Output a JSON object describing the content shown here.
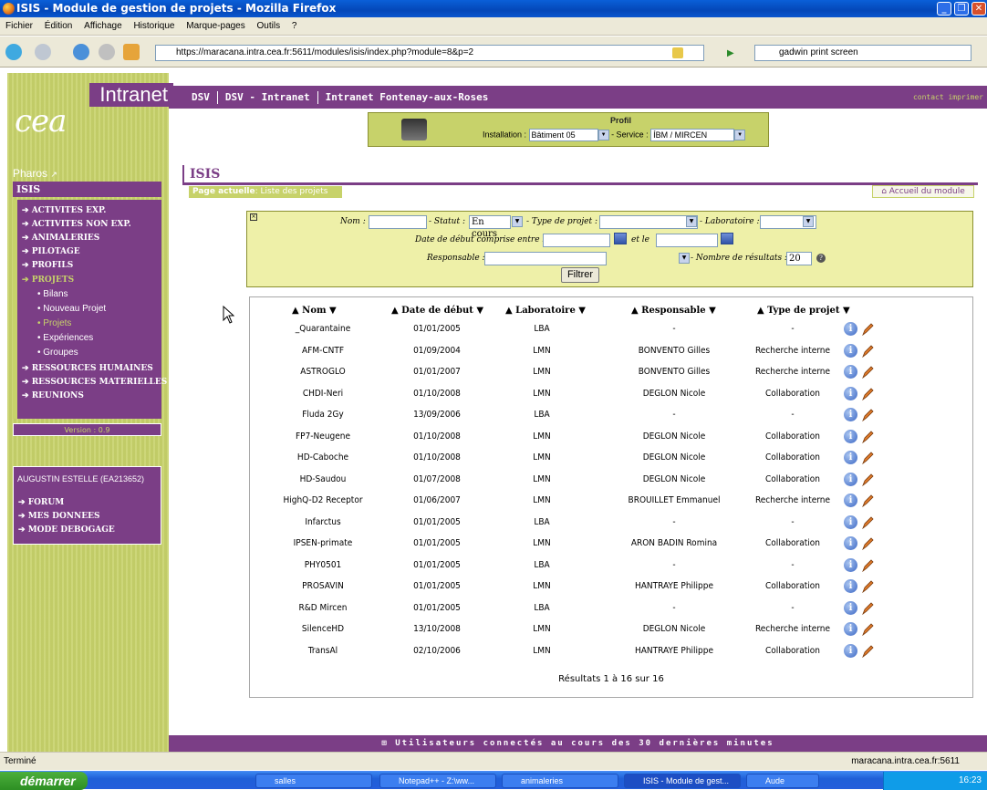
{
  "window": {
    "title": "ISIS - Module de gestion de projets - Mozilla Firefox"
  },
  "menu": [
    "Fichier",
    "Édition",
    "Affichage",
    "Historique",
    "Marque-pages",
    "Outils",
    "?"
  ],
  "nav": {
    "url": "https://maracana.intra.cea.fr:5611/modules/isis/index.php?module=8&p=2",
    "search_value": "gadwin print screen"
  },
  "site": {
    "intranet_label": "Intranet",
    "topnav": [
      "DSV",
      "DSV - Intranet",
      "Intranet Fontenay-aux-Roses"
    ],
    "topnav_right": "contact  imprimer",
    "pharos": "Pharos"
  },
  "profil": {
    "title": "Profil",
    "installation_label": "Installation :",
    "installation_value": "Bâtiment 05",
    "service_label": "- Service :",
    "service_value": "ÍBM / MIRCEN"
  },
  "sidebar": {
    "section": "ISIS",
    "items": [
      {
        "label": "ACTIVITES EXP."
      },
      {
        "label": "ACTIVITES NON EXP."
      },
      {
        "label": "ANIMALERIES"
      },
      {
        "label": "PILOTAGE"
      },
      {
        "label": "PROFILS"
      },
      {
        "label": "PROJETS"
      }
    ],
    "subitems": [
      "Bilans",
      "Nouveau Projet",
      "Projets",
      "Expériences",
      "Groupes"
    ],
    "items2": [
      {
        "label": "RESSOURCES HUMAINES"
      },
      {
        "label": "RESSOURCES MATERIELLES"
      },
      {
        "label": "REUNIONS"
      }
    ],
    "version": "Version : 0.9",
    "user": "AUGUSTIN ESTELLE (EA213652)",
    "user_items": [
      "FORUM",
      "MES DONNEES",
      "MODE DEBOGAGE"
    ]
  },
  "page": {
    "title": "ISIS",
    "current_label": "Page actuelle",
    "current_value": ": Liste des projets",
    "home_link": "Accueil du module"
  },
  "filter": {
    "nom_label": "Nom :",
    "statut_label": "- Statut :",
    "statut_value": "En cours",
    "type_label": "- Type de projet :",
    "labo_label": "- Laboratoire :",
    "date_label": "Date de début comprise entre le",
    "and_label": "et le",
    "resp_label": "Responsable :",
    "nb_label": "- Nombre de résultats :",
    "nb_value": "20",
    "button": "Filtrer"
  },
  "table": {
    "headers": [
      "Nom",
      "Date de début",
      "Laboratoire",
      "Responsable",
      "Type de projet"
    ],
    "rows": [
      [
        "_Quarantaine",
        "01/01/2005",
        "LBA",
        "-",
        "-"
      ],
      [
        "AFM-CNTF",
        "01/09/2004",
        "LMN",
        "BONVENTO Gilles",
        "Recherche interne"
      ],
      [
        "ASTROGLO",
        "01/01/2007",
        "LMN",
        "BONVENTO Gilles",
        "Recherche interne"
      ],
      [
        "CHDI-Neri",
        "01/10/2008",
        "LMN",
        "DEGLON Nicole",
        "Collaboration"
      ],
      [
        "Fluda 2Gy",
        "13/09/2006",
        "LBA",
        "-",
        "-"
      ],
      [
        "FP7-Neugene",
        "01/10/2008",
        "LMN",
        "DEGLON Nicole",
        "Collaboration"
      ],
      [
        "HD-Caboche",
        "01/10/2008",
        "LMN",
        "DEGLON Nicole",
        "Collaboration"
      ],
      [
        "HD-Saudou",
        "01/07/2008",
        "LMN",
        "DEGLON Nicole",
        "Collaboration"
      ],
      [
        "HighQ-D2 Receptor",
        "01/06/2007",
        "LMN",
        "BROUILLET Emmanuel",
        "Recherche interne"
      ],
      [
        "Infarctus",
        "01/01/2005",
        "LBA",
        "-",
        "-"
      ],
      [
        "IPSEN-primate",
        "01/01/2005",
        "LMN",
        "ARON BADIN Romina",
        "Collaboration"
      ],
      [
        "PHY0501",
        "01/01/2005",
        "LBA",
        "-",
        "-"
      ],
      [
        "PROSAVIN",
        "01/01/2005",
        "LMN",
        "HANTRAYE Philippe",
        "Collaboration"
      ],
      [
        "R&D Mircen",
        "01/01/2005",
        "LBA",
        "-",
        "-"
      ],
      [
        "SilenceHD",
        "13/10/2008",
        "LMN",
        "DEGLON Nicole",
        "Recherche interne"
      ],
      [
        "TransAl",
        "02/10/2006",
        "LMN",
        "HANTRAYE Philippe",
        "Collaboration"
      ]
    ],
    "results": "Résultats 1 à 16 sur 16"
  },
  "footer": {
    "connected": "Utilisateurs connectés au cours des 30 dernières minutes"
  },
  "status": {
    "left": "Terminé",
    "right": "maracana.intra.cea.fr:5611"
  },
  "taskbar": {
    "start": "démarrer",
    "tasks": [
      "salles",
      "Notepad++ - Z:\\ww...",
      "animaleries",
      "ISIS - Module de gest...",
      "Aude"
    ],
    "clock": "16:23"
  }
}
